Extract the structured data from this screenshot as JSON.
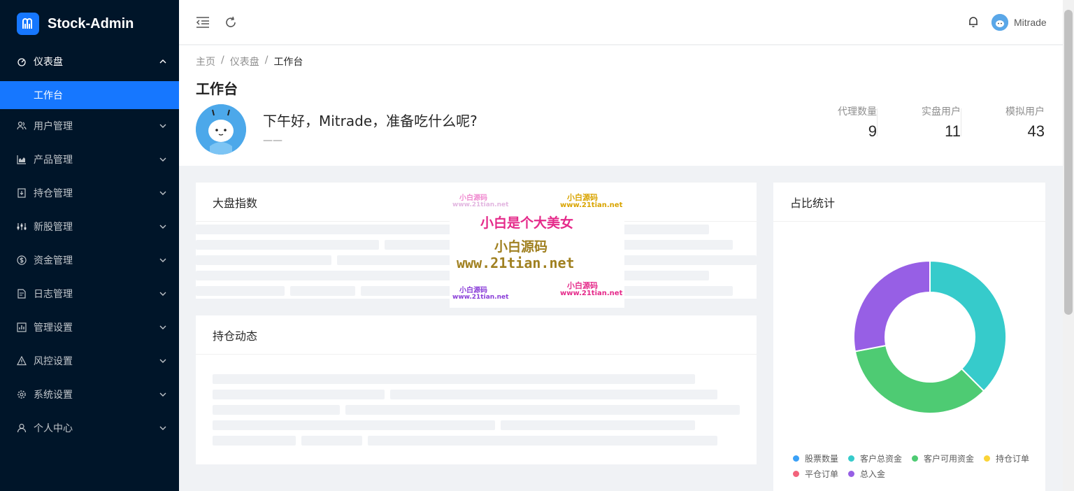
{
  "app": {
    "name": "Stock-Admin"
  },
  "sidebar": {
    "dashboard": {
      "label": "仪表盘",
      "sub": "工作台"
    },
    "items": [
      {
        "label": "用户管理",
        "icon": "users-icon"
      },
      {
        "label": "产品管理",
        "icon": "chart-icon"
      },
      {
        "label": "持仓管理",
        "icon": "download-box-icon"
      },
      {
        "label": "新股管理",
        "icon": "sliders-icon"
      },
      {
        "label": "资金管理",
        "icon": "dollar-circle-icon"
      },
      {
        "label": "日志管理",
        "icon": "file-icon"
      },
      {
        "label": "管理设置",
        "icon": "bar-chart-box-icon"
      },
      {
        "label": "风控设置",
        "icon": "warning-icon"
      },
      {
        "label": "系统设置",
        "icon": "gear-icon"
      },
      {
        "label": "个人中心",
        "icon": "user-icon"
      }
    ]
  },
  "header": {
    "username": "Mitrade"
  },
  "breadcrumb": [
    "主页",
    "仪表盘",
    "工作台"
  ],
  "page": {
    "title": "工作台",
    "greeting": "下午好，Mitrade，准备吃什么呢?",
    "greeting_sub": "——"
  },
  "stats": [
    {
      "label": "代理数量",
      "value": "9"
    },
    {
      "label": "实盘用户",
      "value": "11"
    },
    {
      "label": "模拟用户",
      "value": "43"
    }
  ],
  "cards": {
    "market": "大盘指数",
    "positions": "持仓动态",
    "ratio": "占比统计"
  },
  "watermark": {
    "small": "小白源码",
    "small_url": "www.21tian.net",
    "line1": "小白是个大美女",
    "line2": "小白源码",
    "url": "www.21tian.net"
  },
  "chart_data": {
    "type": "pie",
    "categories": [
      "股票数量",
      "客户总资金",
      "客户可用资金",
      "持仓订单",
      "平仓订单",
      "总入金"
    ],
    "values": [
      0,
      37.5,
      34.5,
      0,
      0,
      28
    ],
    "colors": [
      "#3ba1f7",
      "#36cbcb",
      "#4ecb73",
      "#fbd437",
      "#f2637b",
      "#975fe5"
    ],
    "donut": true,
    "legend": "bottom"
  }
}
